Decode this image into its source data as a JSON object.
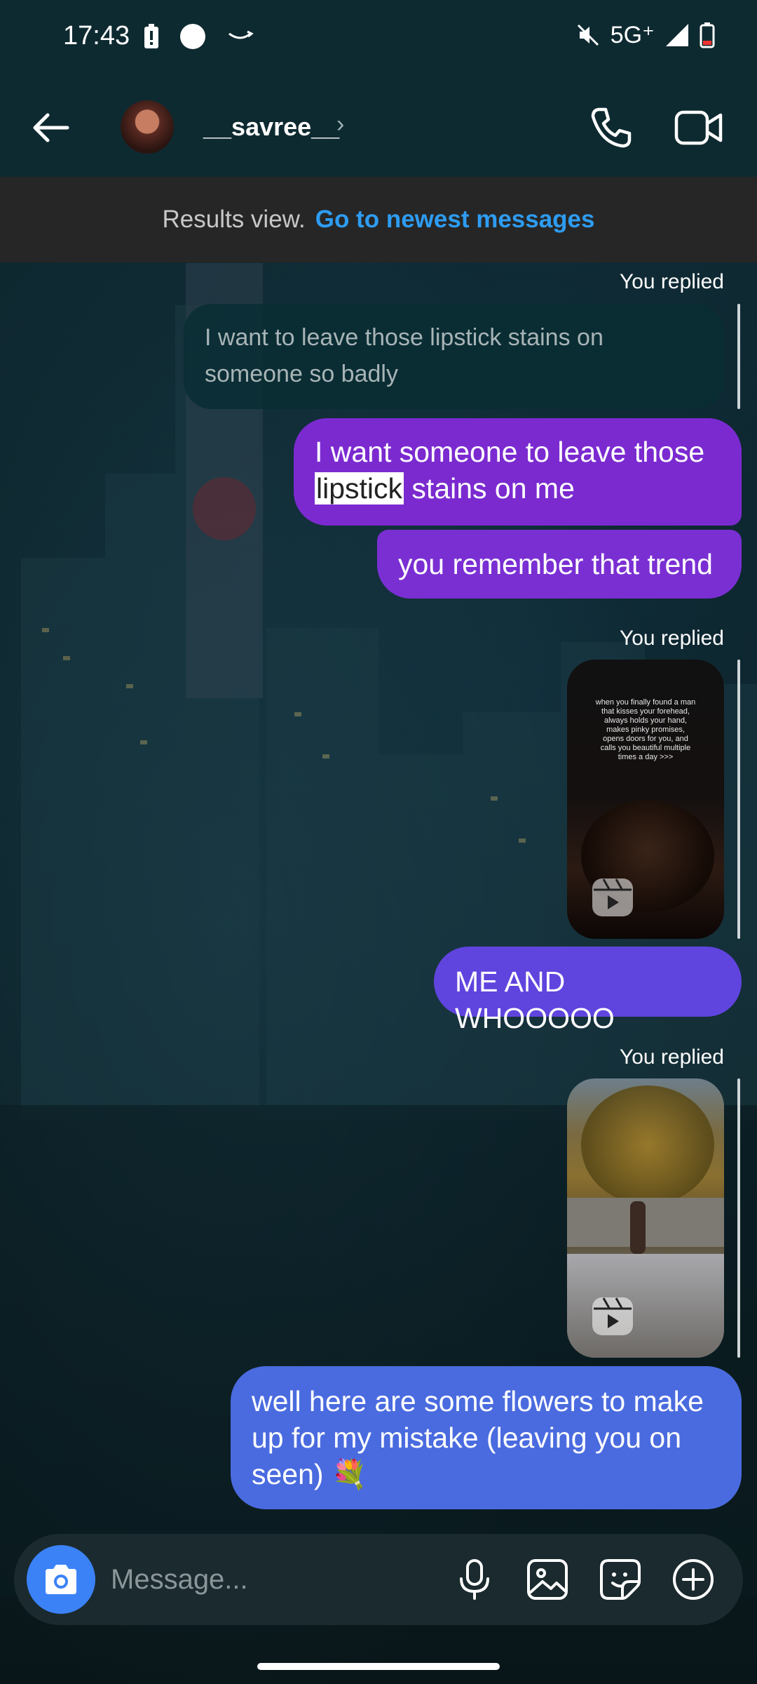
{
  "status_bar": {
    "time": "17:43",
    "network": "5G⁺"
  },
  "header": {
    "username": "__savree__",
    "chevron": "›"
  },
  "banner": {
    "text": "Results view.",
    "link": "Go to newest messages"
  },
  "messages": {
    "replied_1": "You replied",
    "quoted_text": "I want to leave those lipstick stains on someone so badly",
    "msg1_before": "I want someone to leave those ",
    "msg1_highlight": "lipstick",
    "msg1_after": " stains on me",
    "msg2": "you remember that trend",
    "replied_2": "You replied",
    "reel1_caption": "when you finally found a man that kisses your forehead, always holds your hand, makes pinky promises, opens doors for you, and calls you beautiful multiple times a day >>>",
    "msg3": "ME AND WHOOOOO",
    "replied_3": "You replied",
    "msg4": "well here are some flowers to make up for my mistake (leaving you on seen) 💐"
  },
  "composer": {
    "placeholder": "Message..."
  },
  "icons": [
    "back-arrow-icon",
    "phone-icon",
    "video-call-icon",
    "camera-icon",
    "microphone-icon",
    "gallery-icon",
    "sticker-icon",
    "plus-circle-icon",
    "reel-icon"
  ],
  "colors": {
    "bubble_purple": "#7b2ad0",
    "bubble_violet": "#6044de",
    "bubble_blue": "#4a6bdf",
    "link_blue": "#2e9cf2"
  }
}
